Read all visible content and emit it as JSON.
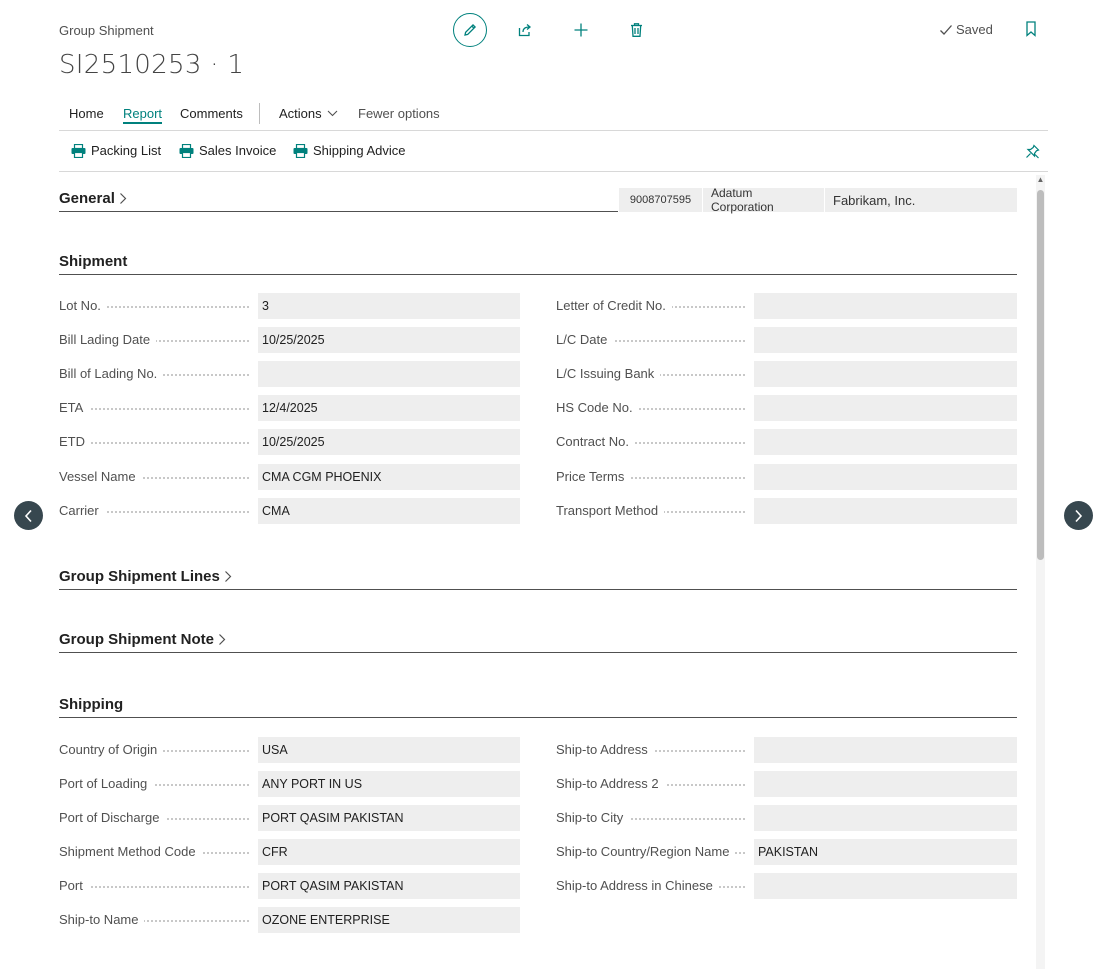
{
  "header": {
    "caption": "Group Shipment",
    "title": "SI2510253 · 1",
    "status": "Saved"
  },
  "tabs": [
    "Home",
    "Report",
    "Comments",
    "Actions",
    "Fewer options"
  ],
  "reports": [
    "Packing List",
    "Sales Invoice",
    "Shipping Advice"
  ],
  "sections": {
    "general": "General",
    "shipment": "Shipment",
    "lines": "Group Shipment Lines",
    "note": "Group Shipment Note",
    "shipping": "Shipping"
  },
  "general_pills": [
    "9008707595",
    "Adatum Corporation",
    "Fabrikam, Inc."
  ],
  "shipment": {
    "left": [
      {
        "label": "Lot No.",
        "value": "3"
      },
      {
        "label": "Bill Lading Date",
        "value": "10/25/2025"
      },
      {
        "label": "Bill of Lading No.",
        "value": ""
      },
      {
        "label": "ETA",
        "value": "12/4/2025"
      },
      {
        "label": "ETD",
        "value": "10/25/2025"
      },
      {
        "label": "Vessel Name",
        "value": "CMA CGM PHOENIX"
      },
      {
        "label": "Carrier",
        "value": "CMA"
      }
    ],
    "right": [
      {
        "label": "Letter of Credit No.",
        "value": ""
      },
      {
        "label": "L/C Date",
        "value": ""
      },
      {
        "label": "L/C Issuing Bank",
        "value": ""
      },
      {
        "label": "HS Code No.",
        "value": ""
      },
      {
        "label": "Contract No.",
        "value": ""
      },
      {
        "label": "Price Terms",
        "value": ""
      },
      {
        "label": "Transport Method",
        "value": ""
      }
    ]
  },
  "shipping": {
    "left": [
      {
        "label": "Country of Origin",
        "value": "USA"
      },
      {
        "label": "Port of Loading",
        "value": "ANY PORT IN US"
      },
      {
        "label": "Port of Discharge",
        "value": "PORT QASIM PAKISTAN"
      },
      {
        "label": "Shipment Method Code",
        "value": "CFR"
      },
      {
        "label": "Port",
        "value": "PORT QASIM PAKISTAN"
      },
      {
        "label": "Ship-to Name",
        "value": "OZONE ENTERPRISE"
      }
    ],
    "right": [
      {
        "label": "Ship-to Address",
        "value": ""
      },
      {
        "label": "Ship-to Address 2",
        "value": ""
      },
      {
        "label": "Ship-to City",
        "value": ""
      },
      {
        "label": "Ship-to Country/Region Name",
        "value": "PAKISTAN"
      },
      {
        "label": "Ship-to Address in Chinese",
        "value": ""
      }
    ]
  },
  "icons": {
    "edit": "pencil-icon",
    "share": "share-icon",
    "add": "plus-icon",
    "delete": "trash-icon",
    "bookmark": "bookmark-icon",
    "print": "printer-icon",
    "pin": "pin-icon"
  },
  "colors": {
    "accent": "#00817d",
    "field_bg": "#eeeeee",
    "nav": "#37474f"
  }
}
